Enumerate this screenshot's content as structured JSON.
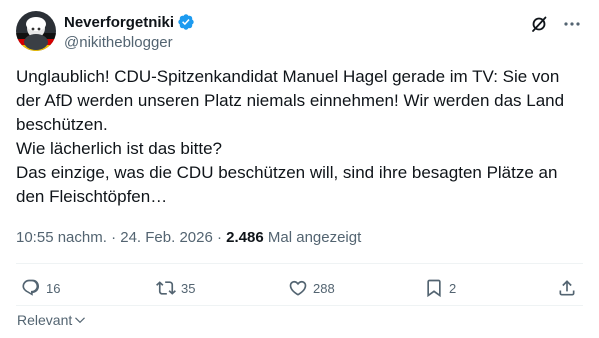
{
  "author": {
    "display_name": "Neverforgetniki",
    "handle": "@nikitheblogger",
    "verified": true
  },
  "tweet": {
    "lines": [
      "Unglaublich! CDU-Spitzenkandidat Manuel Hagel gerade im TV: Sie von",
      "der AfD werden unseren Platz niemals einnehmen! Wir werden das Land",
      "beschützen.",
      "Wie lächerlich ist das bitte?",
      "Das einzige, was die CDU beschützen will, sind ihre besagten Plätze an",
      "den Fleischtöpfen…"
    ]
  },
  "meta": {
    "time": "10:55 nachm.",
    "sep1": " · ",
    "date": "24. Feb. 2026",
    "sep2": " · ",
    "views": "2.486",
    "views_label": " Mal angezeigt"
  },
  "actions": {
    "replies": "16",
    "reposts": "35",
    "likes": "288",
    "bookmarks": "2"
  },
  "sort": {
    "label": "Relevant"
  },
  "colors": {
    "verified": "#1d9bf0",
    "text": "#0f1419",
    "secondary": "#536471",
    "divider": "#eff3f4"
  },
  "icons": [
    "verified-badge-icon",
    "grok-icon",
    "more-icon",
    "reply-icon",
    "repost-icon",
    "like-icon",
    "bookmark-icon",
    "share-icon",
    "chevron-down-icon"
  ]
}
